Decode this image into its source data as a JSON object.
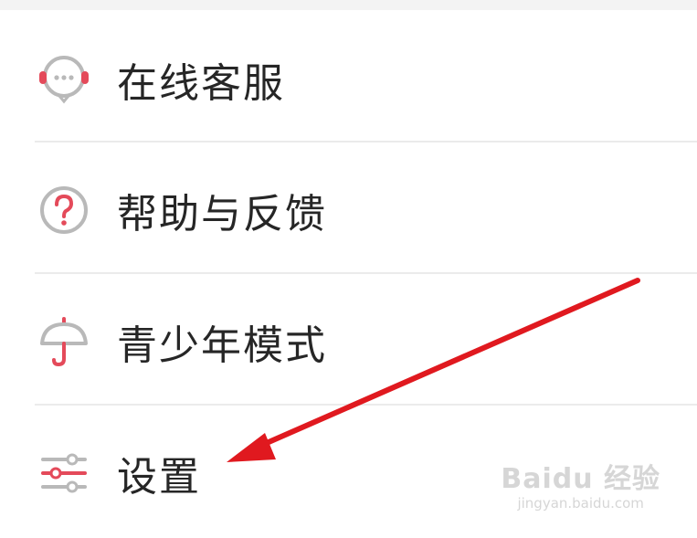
{
  "menu": {
    "items": [
      {
        "label": "在线客服",
        "icon": "headset-icon"
      },
      {
        "label": "帮助与反馈",
        "icon": "question-circle-icon"
      },
      {
        "label": "青少年模式",
        "icon": "umbrella-icon"
      },
      {
        "label": "设置",
        "icon": "sliders-icon"
      }
    ]
  },
  "colors": {
    "accent": "#e44a5a",
    "icon_gray": "#b9b9b9",
    "arrow": "#e0191f",
    "divider": "#ebebeb",
    "text": "#262626"
  },
  "watermark": {
    "brand": "Baidu 经验",
    "url": "jingyan.baidu.com"
  }
}
